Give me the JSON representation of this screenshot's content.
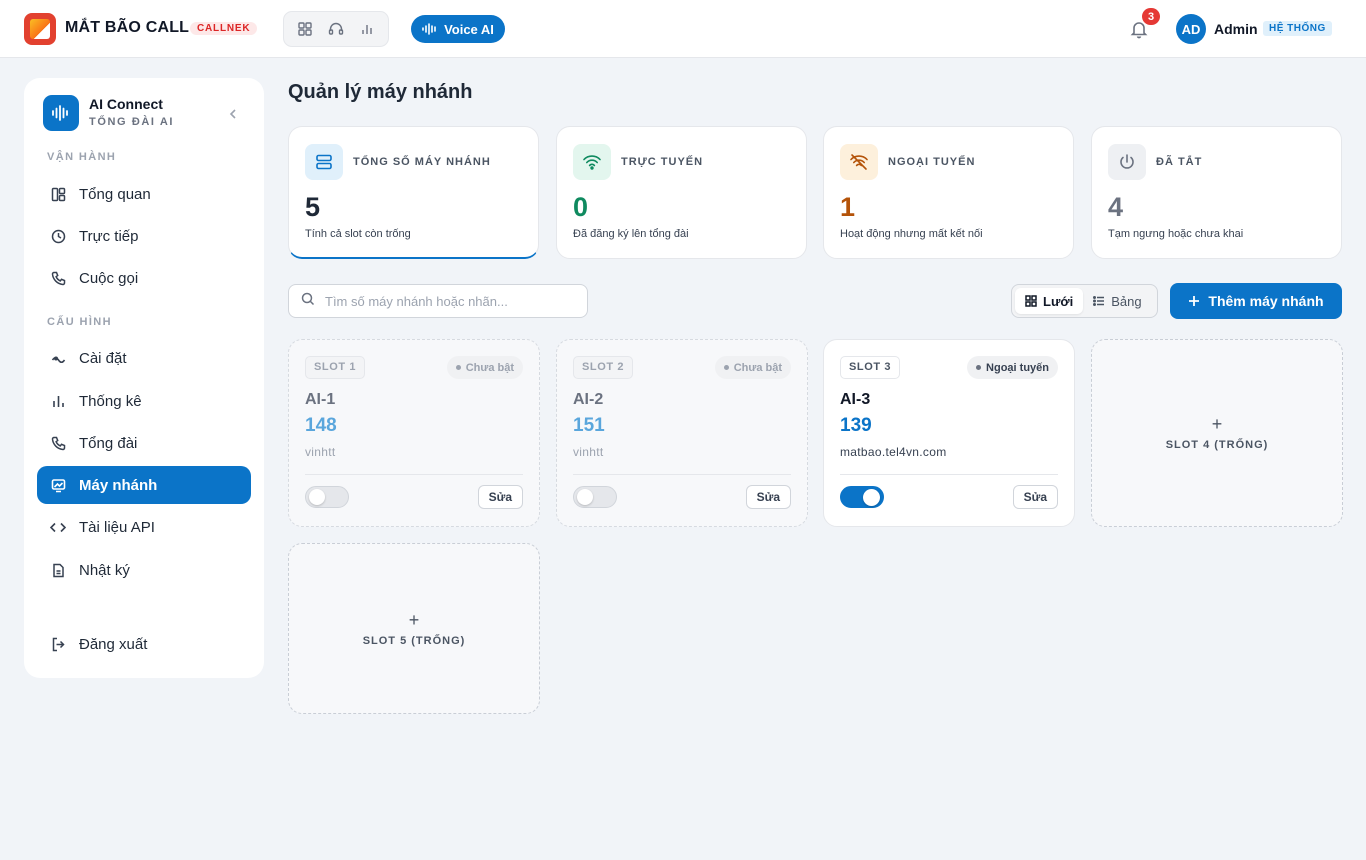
{
  "header": {
    "brand": "MẮT BÃO CALL",
    "brand_tag": "CALLNEK",
    "voice_button": "Voice AI",
    "notification_count": "3",
    "avatar_initials": "AD",
    "user_name": "Admin",
    "user_role": "HỆ THỐNG"
  },
  "sidebar": {
    "title": "AI Connect",
    "subtitle": "TỔNG ĐÀI AI",
    "section_ops": "VẬN HÀNH",
    "section_config": "CẤU HÌNH",
    "items": [
      {
        "label": "Tổng quan",
        "icon": "grid-icon"
      },
      {
        "label": "Trực tiếp",
        "icon": "clock-icon"
      },
      {
        "label": "Cuộc gọi",
        "icon": "phone-icon"
      },
      {
        "label": "Cài đặt",
        "icon": "settings-icon"
      },
      {
        "label": "Thống kê",
        "icon": "bar-chart-icon"
      },
      {
        "label": "Tổng đài",
        "icon": "phone-icon"
      },
      {
        "label": "Máy nhánh",
        "icon": "monitor-icon",
        "active": true
      },
      {
        "label": "Tài liệu API",
        "icon": "code-icon"
      },
      {
        "label": "Nhật ký",
        "icon": "document-icon"
      }
    ],
    "logout": "Đăng xuất"
  },
  "main": {
    "title": "Quản lý máy nhánh",
    "stats": [
      {
        "label": "TỔNG SỐ MÁY NHÁNH",
        "value": "5",
        "desc": "Tính cả slot còn trống",
        "color": "#1f2937",
        "icon": "server-icon"
      },
      {
        "label": "TRỰC TUYẾN",
        "value": "0",
        "desc": "Đã đăng ký lên tổng đài",
        "color": "#0f8a5f",
        "icon": "wifi-icon"
      },
      {
        "label": "NGOẠI TUYẾN",
        "value": "1",
        "desc": "Hoạt động nhưng mất kết nối",
        "color": "#b45309",
        "icon": "wifi-off-icon"
      },
      {
        "label": "ĐÃ TẮT",
        "value": "4",
        "desc": "Tạm ngưng hoặc chưa khai",
        "color": "#6b7280",
        "icon": "power-icon"
      }
    ],
    "search_placeholder": "Tìm số máy nhánh hoặc nhãn...",
    "view_grid": "Lưới",
    "view_table": "Bảng",
    "add_button": "Thêm máy nhánh",
    "slots": [
      {
        "slot": "SLOT 1",
        "status": "Chưa bật",
        "name": "AI-1",
        "ext": "148",
        "host": "vinhtt",
        "enabled": false,
        "edit": "Sửa"
      },
      {
        "slot": "SLOT 2",
        "status": "Chưa bật",
        "name": "AI-2",
        "ext": "151",
        "host": "vinhtt",
        "enabled": false,
        "edit": "Sửa"
      },
      {
        "slot": "SLOT 3",
        "status": "Ngoại tuyến",
        "name": "AI-3",
        "ext": "139",
        "host": "matbao.tel4vn.com",
        "enabled": true,
        "edit": "Sửa"
      }
    ],
    "empty_slots": [
      "SLOT 4 (TRỐNG)",
      "SLOT 5 (TRỐNG)"
    ]
  }
}
